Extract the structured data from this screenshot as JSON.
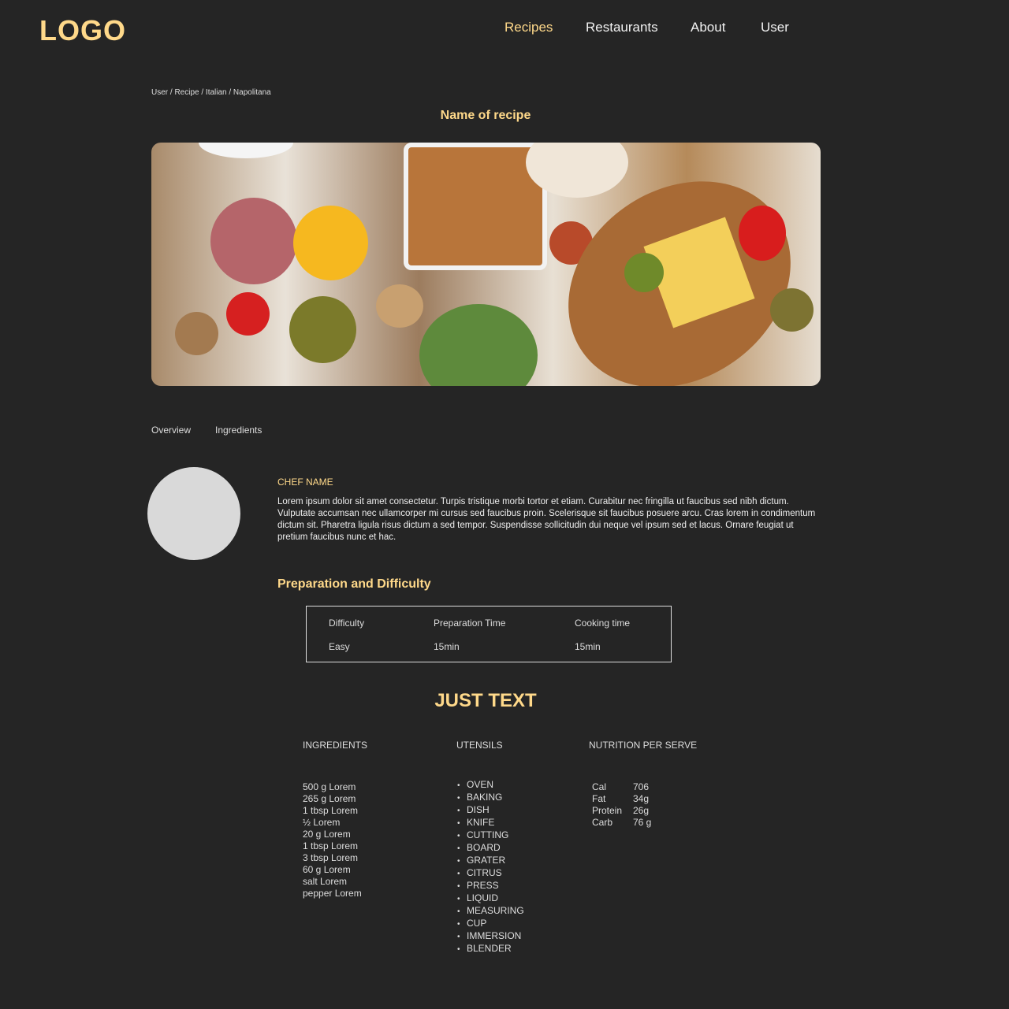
{
  "header": {
    "logo": "LOGO",
    "nav": [
      {
        "label": "Recipes",
        "active": true
      },
      {
        "label": "Restaurants"
      },
      {
        "label": "About"
      },
      {
        "label": "User"
      }
    ]
  },
  "breadcrumb": "User / Recipe / Italian / Napolitana",
  "recipe_title": "Name of recipe",
  "tabs": [
    "Overview",
    "Ingredients"
  ],
  "chef": {
    "name": "CHEF NAME",
    "bio": "Lorem ipsum dolor sit amet consectetur. Turpis tristique morbi tortor et etiam. Curabitur nec fringilla ut faucibus sed nibh dictum. Vulputate accumsan nec ullamcorper mi cursus sed faucibus proin. Scelerisque sit faucibus posuere arcu. Cras lorem in condimentum dictum sit. Pharetra ligula risus dictum a sed tempor. Suspendisse sollicitudin dui neque vel ipsum sed et lacus. Ornare feugiat ut pretium faucibus nunc et hac."
  },
  "prep": {
    "heading": "Preparation and Difficulty",
    "headers": [
      "Difficulty",
      "Preparation Time",
      "Cooking time"
    ],
    "values": [
      "Easy",
      "15min",
      "15min"
    ]
  },
  "section_title": "JUST TEXT",
  "ingredients": {
    "heading": "INGREDIENTS",
    "items": [
      "500 g Lorem",
      "265 g Lorem",
      "1 tbsp Lorem",
      "½ Lorem",
      "20 g Lorem",
      "1 tbsp Lorem",
      "3 tbsp Lorem",
      "60 g Lorem",
      "salt Lorem",
      "pepper Lorem"
    ]
  },
  "utensils": {
    "heading": "UTENSILS",
    "items": [
      "OVEN",
      "BAKING",
      "DISH",
      "KNIFE",
      "CUTTING",
      "BOARD",
      "GRATER",
      "CITRUS",
      "PRESS",
      "LIQUID",
      "MEASURING",
      "CUP",
      "IMMERSION",
      "BLENDER"
    ]
  },
  "nutrition": {
    "heading": "NUTRITION PER SERVE",
    "rows": [
      {
        "label": "Cal",
        "value": "706"
      },
      {
        "label": "Fat",
        "value": "34g"
      },
      {
        "label": "Protein",
        "value": "26g"
      },
      {
        "label": "Carb",
        "value": "76 g"
      }
    ]
  },
  "colors": {
    "background": "#252525",
    "accent": "#ffd98a"
  }
}
